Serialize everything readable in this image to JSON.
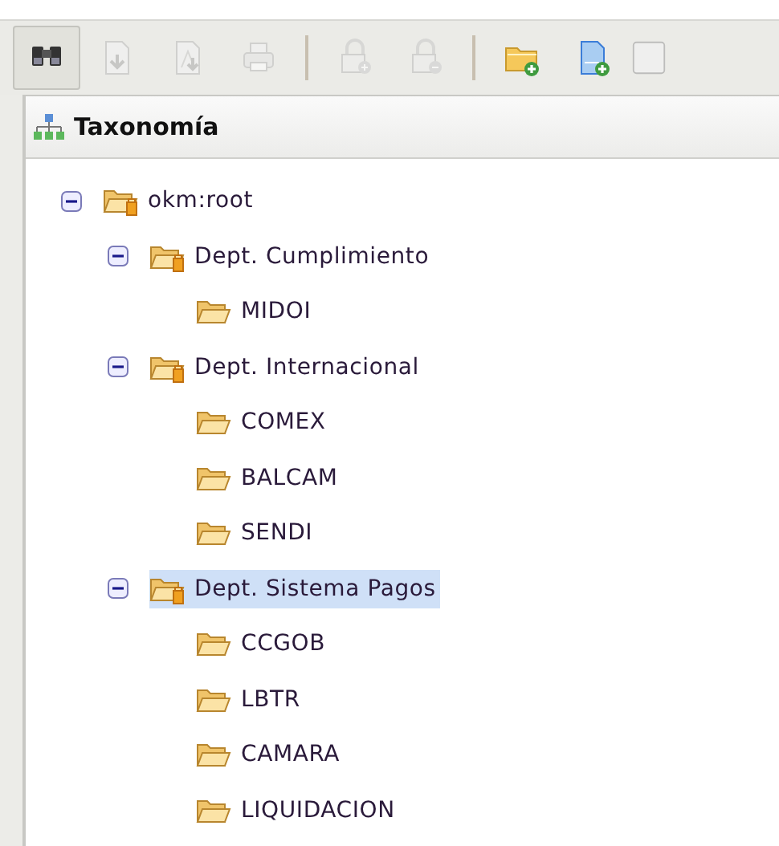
{
  "toolbar": {
    "buttons": [
      {
        "kind": "binoculars",
        "disabled": false,
        "pressed": true
      },
      {
        "kind": "download",
        "disabled": true,
        "pressed": false
      },
      {
        "kind": "pdf-download",
        "disabled": true,
        "pressed": false
      },
      {
        "kind": "print",
        "disabled": true,
        "pressed": false
      },
      {
        "kind": "separator"
      },
      {
        "kind": "lock-add",
        "disabled": true,
        "pressed": false
      },
      {
        "kind": "lock-remove",
        "disabled": true,
        "pressed": false
      },
      {
        "kind": "separator"
      },
      {
        "kind": "folder-add",
        "disabled": false,
        "pressed": false
      },
      {
        "kind": "document-add",
        "disabled": false,
        "pressed": false
      },
      {
        "kind": "partial",
        "disabled": true,
        "pressed": false
      }
    ]
  },
  "panel": {
    "title": "Taxonomía"
  },
  "tree": [
    {
      "label": "okm:root",
      "kind": "locked",
      "expanded": true,
      "selected": false,
      "children": [
        {
          "label": "Dept. Cumplimiento",
          "kind": "locked",
          "expanded": true,
          "selected": false,
          "children": [
            {
              "label": "MIDOI",
              "kind": "folder",
              "selected": false
            }
          ]
        },
        {
          "label": "Dept. Internacional",
          "kind": "locked",
          "expanded": true,
          "selected": false,
          "children": [
            {
              "label": "COMEX",
              "kind": "folder",
              "selected": false
            },
            {
              "label": "BALCAM",
              "kind": "folder",
              "selected": false
            },
            {
              "label": "SENDI",
              "kind": "folder",
              "selected": false
            }
          ]
        },
        {
          "label": "Dept. Sistema Pagos",
          "kind": "locked",
          "expanded": true,
          "selected": true,
          "children": [
            {
              "label": "CCGOB",
              "kind": "folder",
              "selected": false
            },
            {
              "label": "LBTR",
              "kind": "folder",
              "selected": false
            },
            {
              "label": "CAMARA",
              "kind": "folder",
              "selected": false
            },
            {
              "label": "LIQUIDACION",
              "kind": "folder",
              "selected": false
            }
          ]
        }
      ]
    }
  ]
}
